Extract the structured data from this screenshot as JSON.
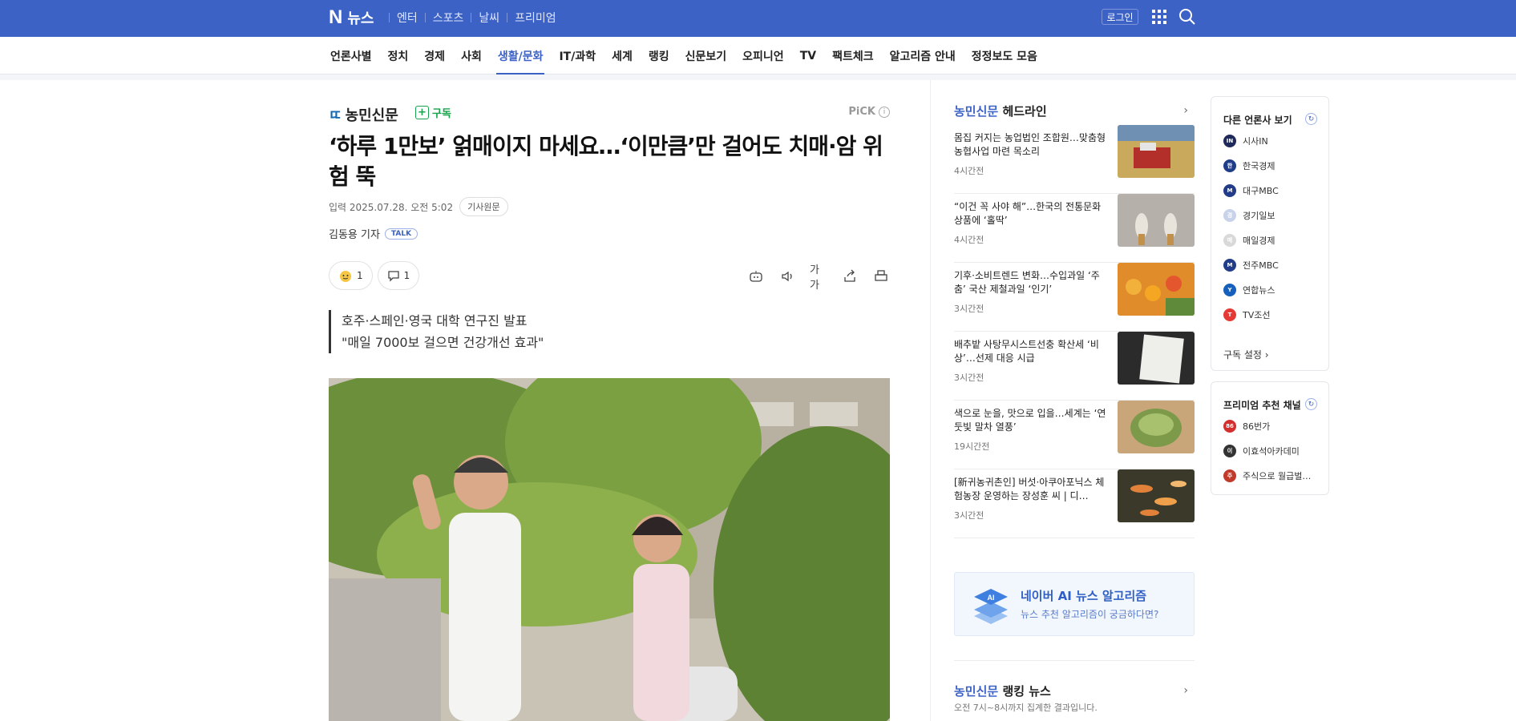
{
  "header": {
    "logo": "N",
    "service": "뉴스",
    "nav": [
      "엔터",
      "스포츠",
      "날씨",
      "프리미엄"
    ],
    "login": "로그인",
    "brand_color": "#3d62c6"
  },
  "categories": [
    {
      "label": "언론사별",
      "active": false
    },
    {
      "label": "정치",
      "active": false
    },
    {
      "label": "경제",
      "active": false
    },
    {
      "label": "사회",
      "active": false
    },
    {
      "label": "생활/문화",
      "active": true
    },
    {
      "label": "IT/과학",
      "active": false
    },
    {
      "label": "세계",
      "active": false
    },
    {
      "label": "랭킹",
      "active": false
    },
    {
      "label": "신문보기",
      "active": false
    },
    {
      "label": "오피니언",
      "active": false
    },
    {
      "label": "TV",
      "active": false
    },
    {
      "label": "팩트체크",
      "active": false
    },
    {
      "label": "알고리즘 안내",
      "active": false
    },
    {
      "label": "정정보도 모음",
      "active": false
    }
  ],
  "article": {
    "press_mark": "ㄸ",
    "press_name": "농민신문",
    "subscribe": "구독",
    "pick": "PiCK",
    "title": "‘하루 1만보’ 얽매이지 마세요…‘이만큼’만 걸어도 치매·암 위험 뚝",
    "date": "입력 2025.07.28. 오전 5:02",
    "origin_button": "기사원문",
    "reporter": "김동용 기자",
    "talk": "TALK",
    "reaction_count": "1",
    "comment_count": "1",
    "text_size_label": "가가",
    "summary": [
      "호주·스페인·영국 대학 연구진 발표",
      "\"매일 7000보 걸으면 건강개선 효과\""
    ]
  },
  "sidebar": {
    "headline_press": "농민신문",
    "headline_title": "헤드라인",
    "headlines": [
      {
        "title": "몸집 커지는 농업법인 조합원…맞춤형 농협사업 마련 목소리",
        "time": "4시간전"
      },
      {
        "title": "“이건 꼭 사야 해”…한국의 전통문화 상품에 ‘홀딱’",
        "time": "4시간전"
      },
      {
        "title": "기후·소비트렌드 변화…수입과일 ‘주춤’ 국산 제철과일 ‘인기’",
        "time": "3시간전"
      },
      {
        "title": "배추밭 사탕무시스트선충 확산세 ‘비상’…선제 대응 시급",
        "time": "3시간전"
      },
      {
        "title": "색으로 눈을, 맛으로 입을…세계는 ‘연둣빛 말차 열풍’",
        "time": "19시간전"
      },
      {
        "title": "[新귀농귀촌인] 버섯·아쿠아포닉스 체험농장 운영하는 장성훈 씨 | 디…",
        "time": "3시간전"
      }
    ],
    "ai_title": "네이버 AI 뉴스 알고리즘",
    "ai_sub": "뉴스 추천 알고리즘이 궁금하다면?",
    "ai_badge": "AI",
    "ranking_press": "농민신문",
    "ranking_title": "랭킹 뉴스",
    "ranking_sub": "오전 7시~8시까지 집계한 결과입니다."
  },
  "press_card": {
    "title": "다른 언론사 보기",
    "items": [
      {
        "name": "시사IN",
        "logo": "IN",
        "color": "#1f2a5a"
      },
      {
        "name": "한국경제",
        "logo": "한",
        "color": "#1f3c88"
      },
      {
        "name": "대구MBC",
        "logo": "M",
        "color": "#223c8a"
      },
      {
        "name": "경기일보",
        "logo": "경",
        "color": "#c8d2ea"
      },
      {
        "name": "매일경제",
        "logo": "매",
        "color": "#d9d9d9"
      },
      {
        "name": "전주MBC",
        "logo": "M",
        "color": "#223c8a"
      },
      {
        "name": "연합뉴스",
        "logo": "Y",
        "color": "#1560bd"
      },
      {
        "name": "TV조선",
        "logo": "T",
        "color": "#e53935"
      }
    ],
    "setting": "구독 설정 ›"
  },
  "premium_card": {
    "title": "프리미엄 추천 채널",
    "items": [
      {
        "name": "86번가",
        "logo": "86",
        "color": "#d32f2f"
      },
      {
        "name": "이효석아카데미",
        "logo": "이",
        "color": "#333333"
      },
      {
        "name": "주식으로 월급벌…",
        "logo": "주",
        "color": "#c0392b"
      }
    ]
  }
}
